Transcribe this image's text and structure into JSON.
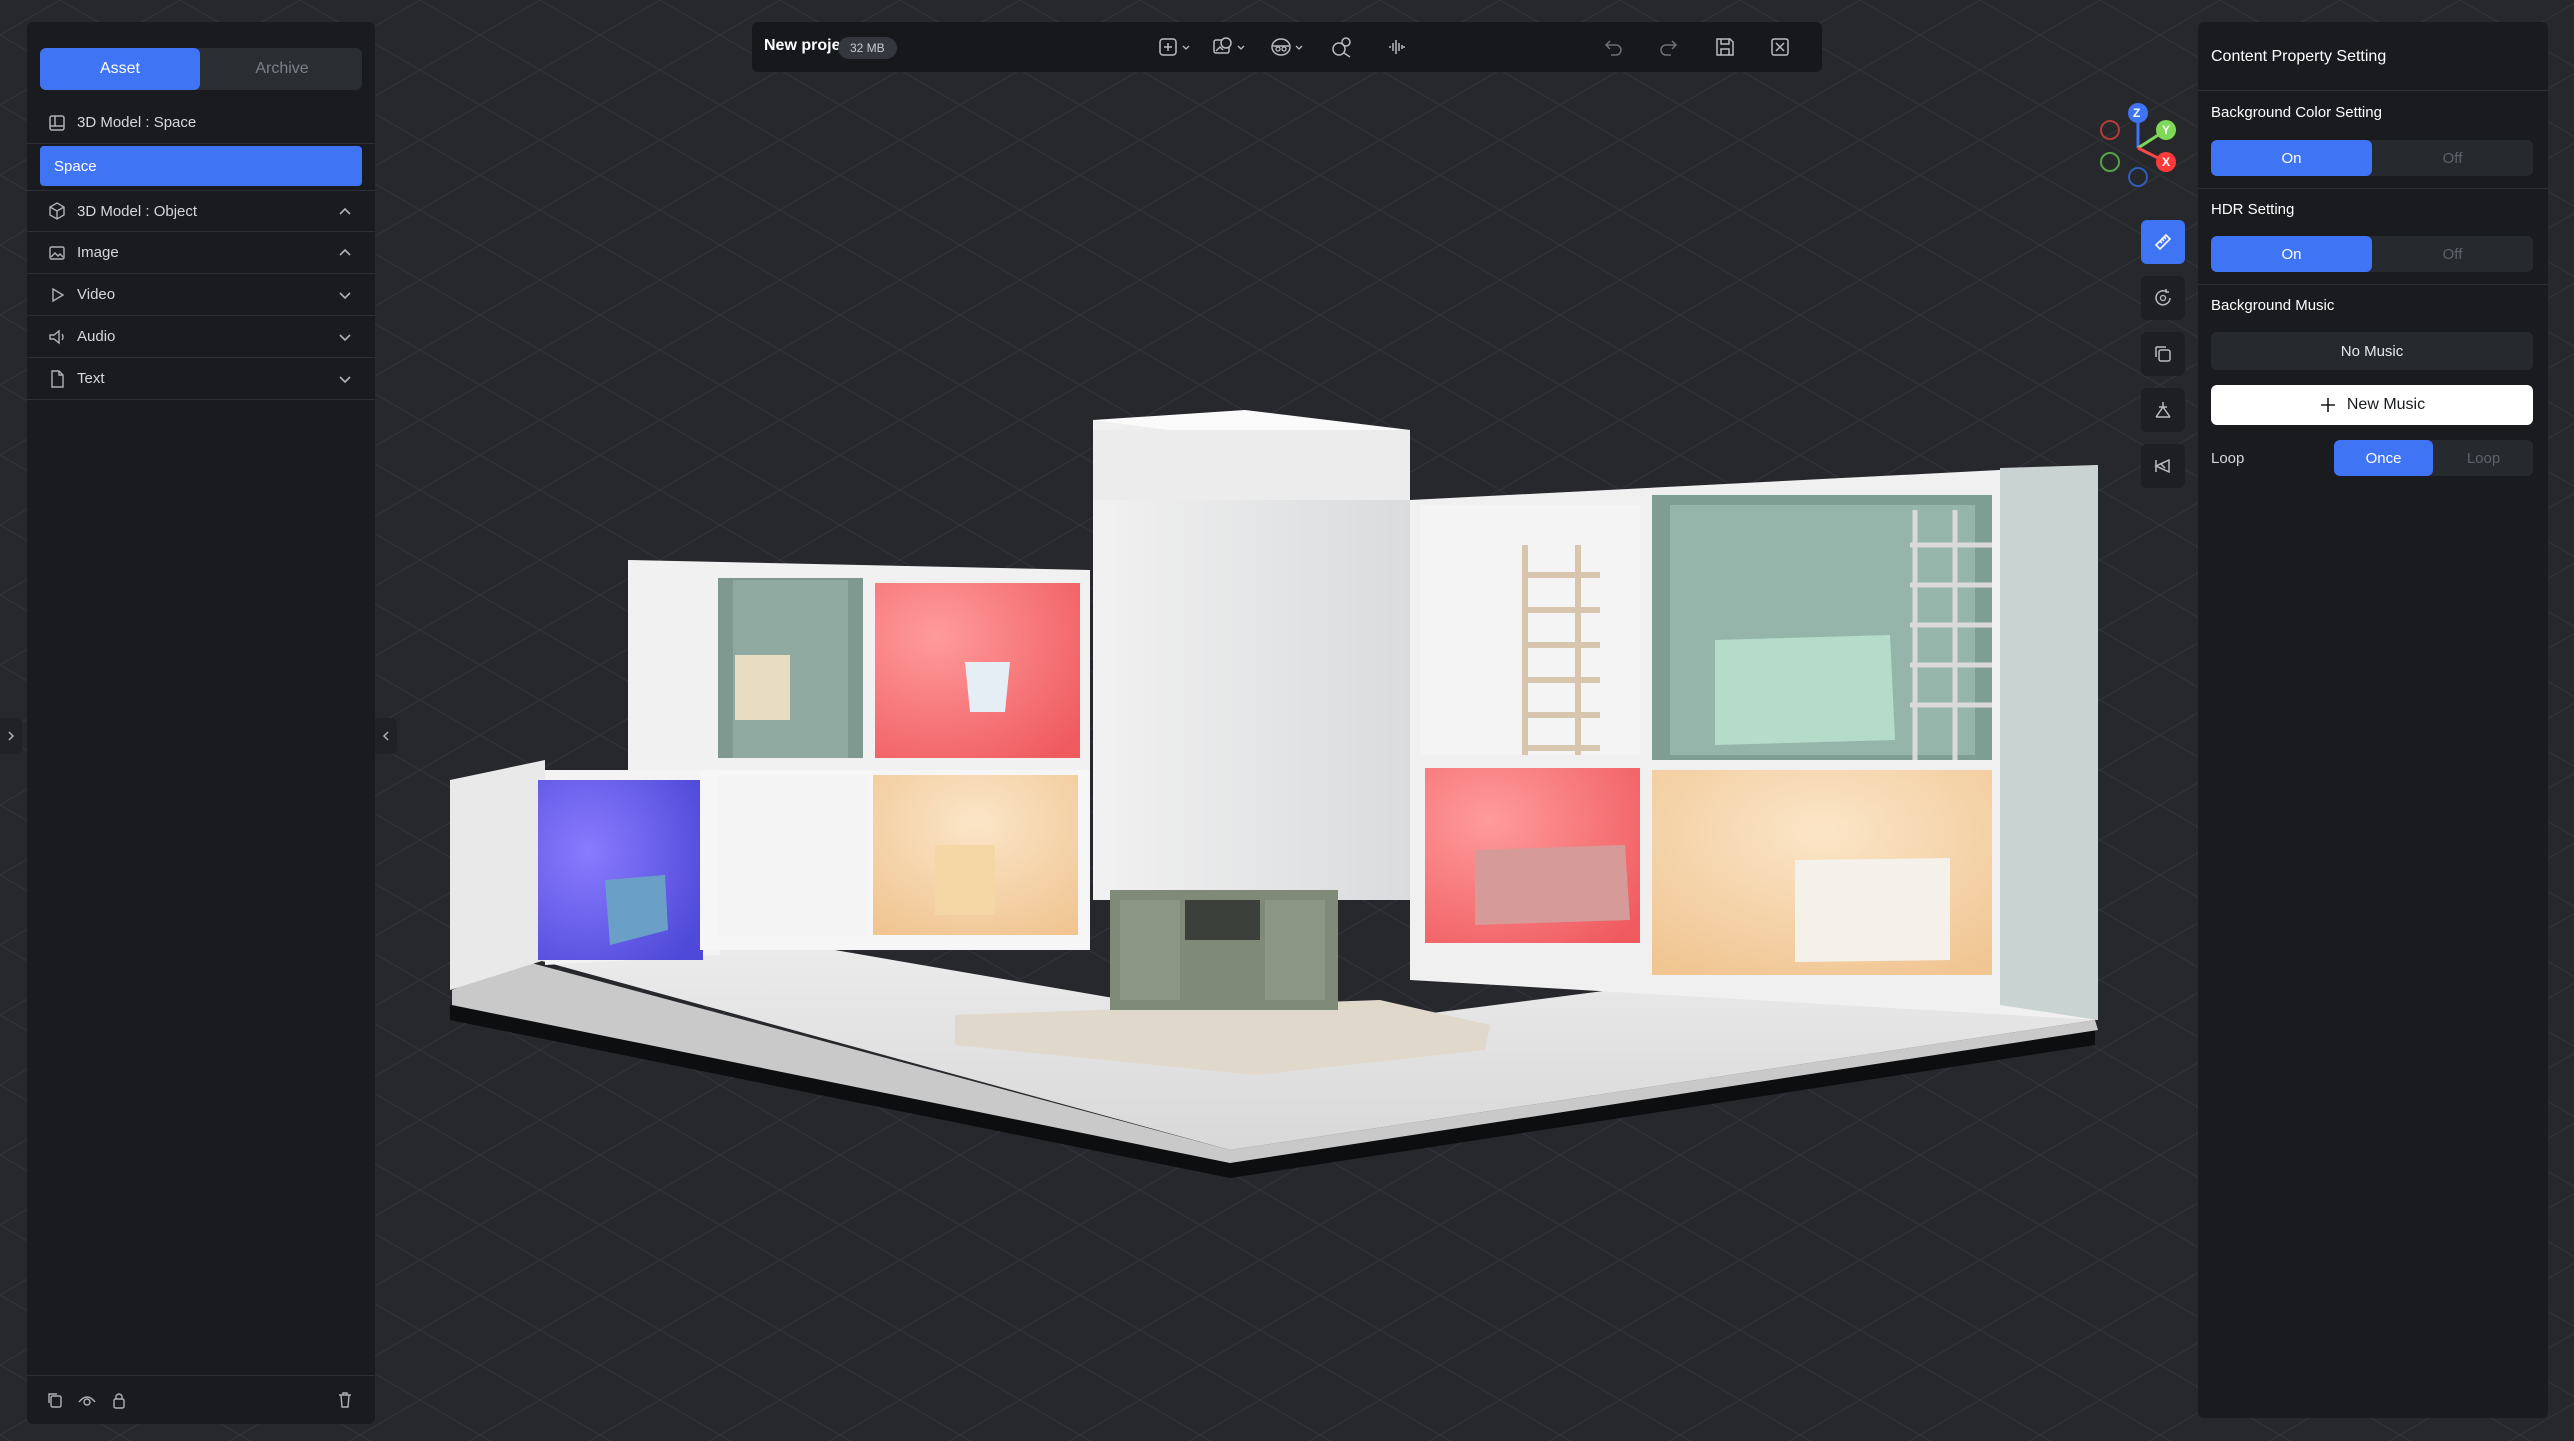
{
  "left_panel": {
    "tabs": [
      {
        "label": "Asset"
      },
      {
        "label": "Archive"
      }
    ],
    "items": [
      {
        "label": "3D Model : Space",
        "icon": "space-icon"
      },
      {
        "label": "Space",
        "selected": true
      },
      {
        "label": "3D Model : Object",
        "icon": "cube-icon",
        "chevron": "chevron-up-icon"
      },
      {
        "label": "Image",
        "icon": "image-icon",
        "chevron": "chevron-up-icon"
      },
      {
        "label": "Video",
        "icon": "play-icon",
        "chevron": "chevron-down-icon"
      },
      {
        "label": "Audio",
        "icon": "speaker-icon",
        "chevron": "chevron-down-icon"
      },
      {
        "label": "Text",
        "icon": "document-icon",
        "chevron": "chevron-down-icon"
      }
    ],
    "bottom_icons": [
      "copy-icon",
      "visibility-icon",
      "lock-icon",
      "trash-icon"
    ]
  },
  "toolbar": {
    "project_name": "New project",
    "size": "32 MB",
    "tools": [
      "add-icon",
      "gallery-icon",
      "camera-view-icon",
      "search-object-icon",
      "waveform-icon",
      "undo-icon",
      "redo-icon",
      "save-icon",
      "exit-icon"
    ]
  },
  "gizmo": {
    "z": "Z",
    "y": "Y",
    "x": "X"
  },
  "side_tools": [
    "ruler-icon",
    "rotate-icon",
    "duplicate-icon",
    "perspective-icon",
    "camera-reset-icon"
  ],
  "right_panel": {
    "title": "Content Property Setting",
    "background_color": {
      "label": "Background Color Setting",
      "on": "On",
      "off": "Off",
      "value": "On"
    },
    "hdr": {
      "label": "HDR Setting",
      "on": "On",
      "off": "Off",
      "value": "On"
    },
    "music": {
      "label": "Background Music",
      "current": "No Music",
      "new_button": "New Music"
    },
    "loop": {
      "label": "Loop",
      "once": "Once",
      "loop": "Loop",
      "value": "Once"
    }
  },
  "colors": {
    "accent": "#3f74f4",
    "panel": "#191b1e",
    "background": "#26282c"
  }
}
